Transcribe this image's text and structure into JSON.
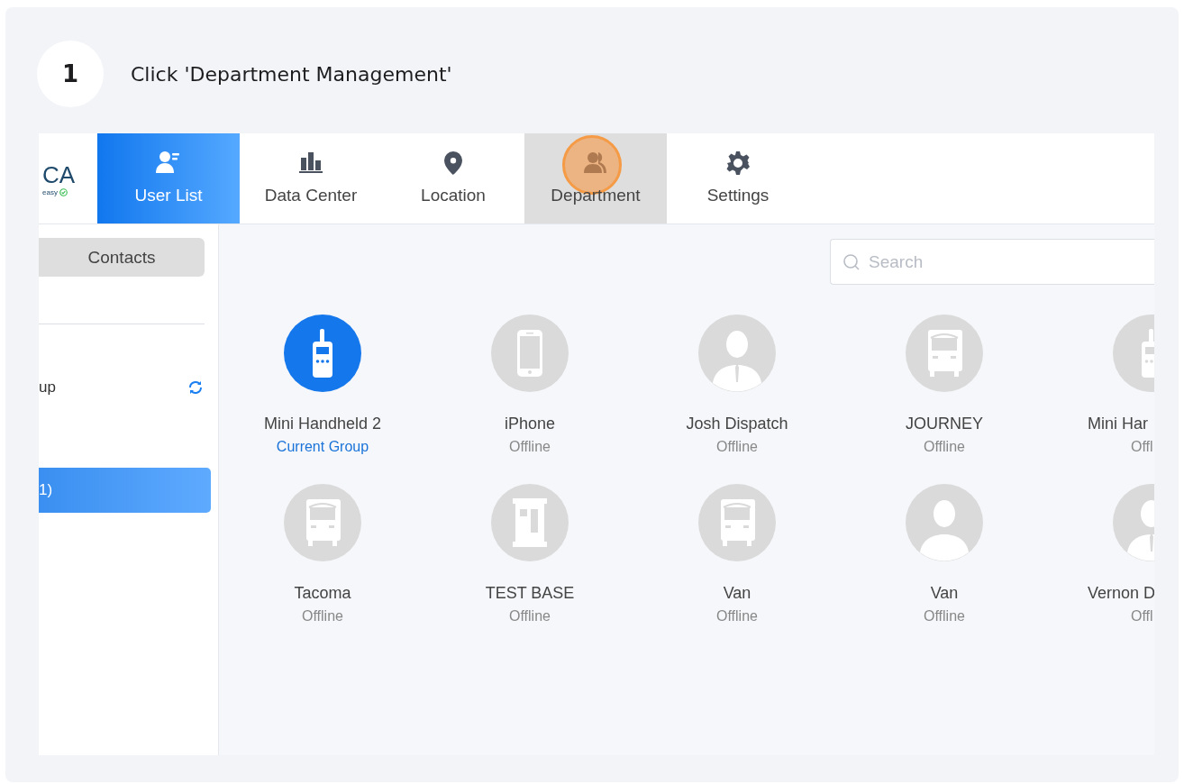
{
  "step": {
    "number": "1",
    "instruction": "Click 'Department Management'"
  },
  "logo": {
    "text": "CA",
    "tagline": "easy"
  },
  "nav_tabs": [
    {
      "label": "User List",
      "kind": "user-list",
      "selected": true,
      "highlighted": false,
      "clicked": false
    },
    {
      "label": "Data Center",
      "kind": "chart",
      "selected": false,
      "highlighted": false,
      "clicked": false
    },
    {
      "label": "Location",
      "kind": "location",
      "selected": false,
      "highlighted": false,
      "clicked": false
    },
    {
      "label": "Department",
      "kind": "department",
      "selected": false,
      "highlighted": true,
      "clicked": true
    },
    {
      "label": "Settings",
      "kind": "settings",
      "selected": false,
      "highlighted": false,
      "clicked": false
    }
  ],
  "sidebar": {
    "contacts_button": "Contacts",
    "items": [
      {
        "label": "up",
        "selected": false,
        "refresh": true
      },
      {
        "label": "1)",
        "selected": true,
        "refresh": false
      }
    ]
  },
  "search": {
    "placeholder": "Search"
  },
  "devices": [
    {
      "name": "Mini Handheld 2",
      "status": "Current Group",
      "kind": "radio",
      "current": true
    },
    {
      "name": "iPhone",
      "status": "Offline",
      "kind": "phone",
      "current": false
    },
    {
      "name": "Josh Dispatch",
      "status": "Offline",
      "kind": "person-tie",
      "current": false
    },
    {
      "name": "JOURNEY",
      "status": "Offline",
      "kind": "truck",
      "current": false
    },
    {
      "name": "Mini Har",
      "status": "Offl",
      "kind": "radio",
      "current": false
    },
    {
      "name": "Tacoma",
      "status": "Offline",
      "kind": "truck",
      "current": false
    },
    {
      "name": "TEST BASE",
      "status": "Offline",
      "kind": "building",
      "current": false
    },
    {
      "name": "Van",
      "status": "Offline",
      "kind": "truck",
      "current": false
    },
    {
      "name": "Van",
      "status": "Offline",
      "kind": "person",
      "current": false
    },
    {
      "name": "Vernon D",
      "status": "Offl",
      "kind": "person-tie",
      "current": false
    }
  ]
}
